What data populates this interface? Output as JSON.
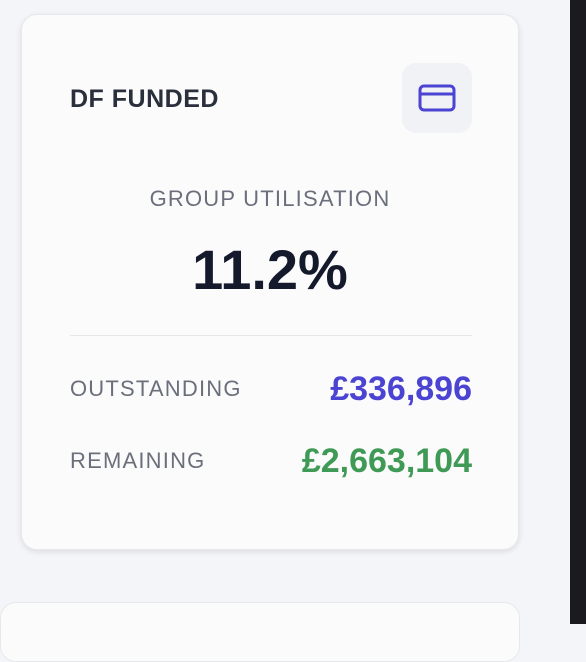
{
  "card": {
    "title": "DF FUNDED",
    "icon": "credit-card-icon",
    "accent_color": "#4b43d1",
    "utilisation": {
      "label": "GROUP UTILISATION",
      "value": "11.2%"
    },
    "outstanding": {
      "label": "OUTSTANDING",
      "value": "£336,896",
      "color": "#4b43d1"
    },
    "remaining": {
      "label": "REMAINING",
      "value": "£2,663,104",
      "color": "#3f9a55"
    }
  }
}
